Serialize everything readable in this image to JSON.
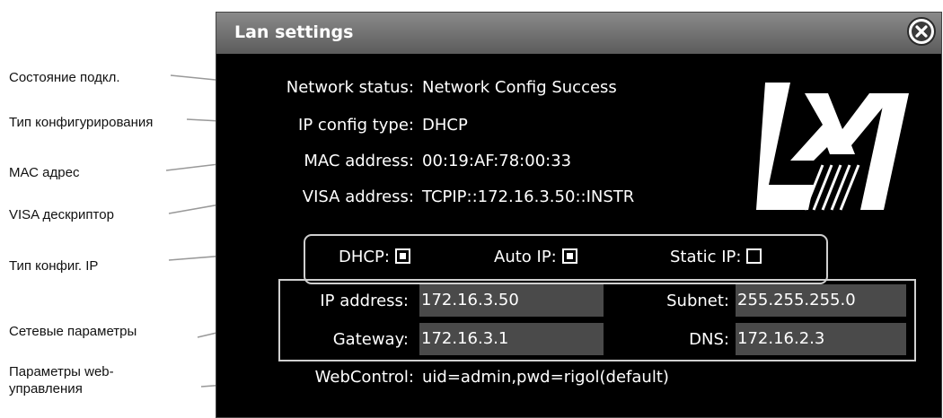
{
  "annotations": [
    "Состояние подкл.",
    "Тип конфигурирования",
    "МАС адрес",
    "VISA дескриптор",
    "Тип конфиг. IP",
    "Сетевые параметры",
    "Параметры web-",
    "управления"
  ],
  "dialog": {
    "title": "Lan settings",
    "close_icon": "close-icon",
    "logo_text": "LXI"
  },
  "info": {
    "network_status_label": "Network status:",
    "network_status_value": "Network Config Success",
    "ip_config_type_label": "IP config type:",
    "ip_config_type_value": "DHCP",
    "mac_label": "MAC address:",
    "mac_value": "00:19:AF:78:00:33",
    "visa_label": "VISA address:",
    "visa_value": "TCPIP::172.16.3.50::INSTR"
  },
  "ip_type": {
    "dhcp_label": "DHCP:",
    "dhcp_checked": true,
    "auto_ip_label": "Auto IP:",
    "auto_ip_checked": true,
    "static_ip_label": "Static IP:",
    "static_ip_checked": false
  },
  "network": {
    "ip_label": "IP address:",
    "ip_value": "172.16.3.50",
    "subnet_label": "Subnet:",
    "subnet_value": "255.255.255.0",
    "gateway_label": "Gateway:",
    "gateway_value": "172.16.3.1",
    "dns_label": "DNS:",
    "dns_value": "172.16.2.3"
  },
  "web": {
    "label": "WebControl:",
    "value": "uid=admin,pwd=rigol(default)"
  }
}
